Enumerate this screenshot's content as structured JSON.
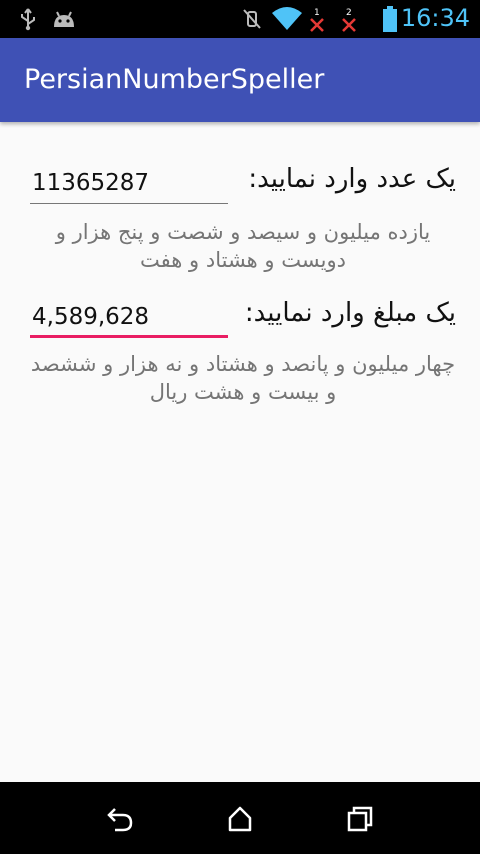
{
  "status_bar": {
    "time": "16:34",
    "sim1_label": "1",
    "sim2_label": "2",
    "icons": [
      "usb-icon",
      "android-debug-icon",
      "mute-icon",
      "wifi-icon",
      "signal-off-icon",
      "signal-off-icon",
      "battery-icon"
    ]
  },
  "app_bar": {
    "title": "PersianNumberSpeller"
  },
  "number_field": {
    "label": "یک عدد وارد نمایید:",
    "value": "11365287",
    "spelled": "یازده میلیون و سیصد و شصت و پنج هزار و دویست و هشتاد و هفت"
  },
  "amount_field": {
    "label": "یک مبلغ وارد نمایید:",
    "value": "4,589,628",
    "spelled": "چهار میلیون و پانصد و هشتاد و نه هزار و ششصد و بیست و هشت ریال"
  },
  "nav_bar": {
    "icons": [
      "back-icon",
      "home-icon",
      "recents-icon"
    ]
  },
  "colors": {
    "primary": "#3f51b5",
    "accent": "#e91e63",
    "status_time": "#4fc3f7"
  }
}
